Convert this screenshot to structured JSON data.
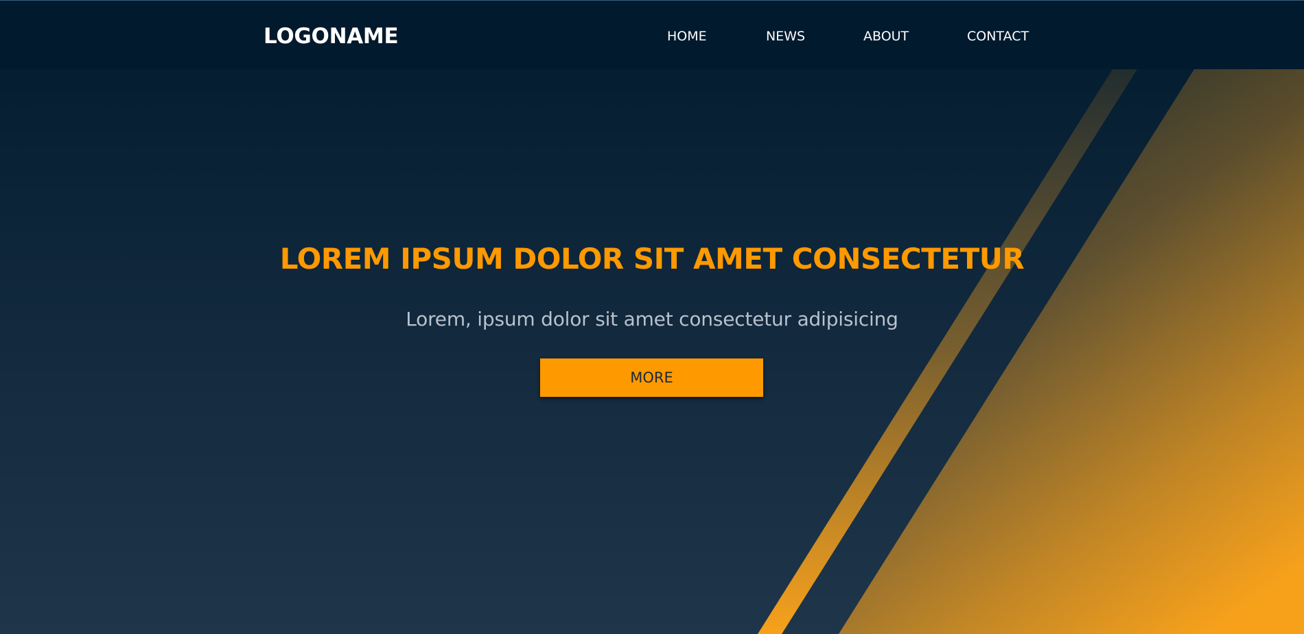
{
  "header": {
    "logo": "LOGONAME",
    "nav": {
      "home": "HOME",
      "news": "NEWS",
      "about": "ABOUT",
      "contact": "CONTACT"
    }
  },
  "hero": {
    "title": "LOREM IPSUM DOLOR SIT AMET CONSECTETUR",
    "subtitle": "Lorem, ipsum dolor sit amet consectetur adipisicing",
    "button_label": "MORE"
  },
  "colors": {
    "accent": "#ff9900",
    "navbar_bg": "#021a2e",
    "background_top": "#011a2d",
    "background_bottom": "#1f3549"
  }
}
